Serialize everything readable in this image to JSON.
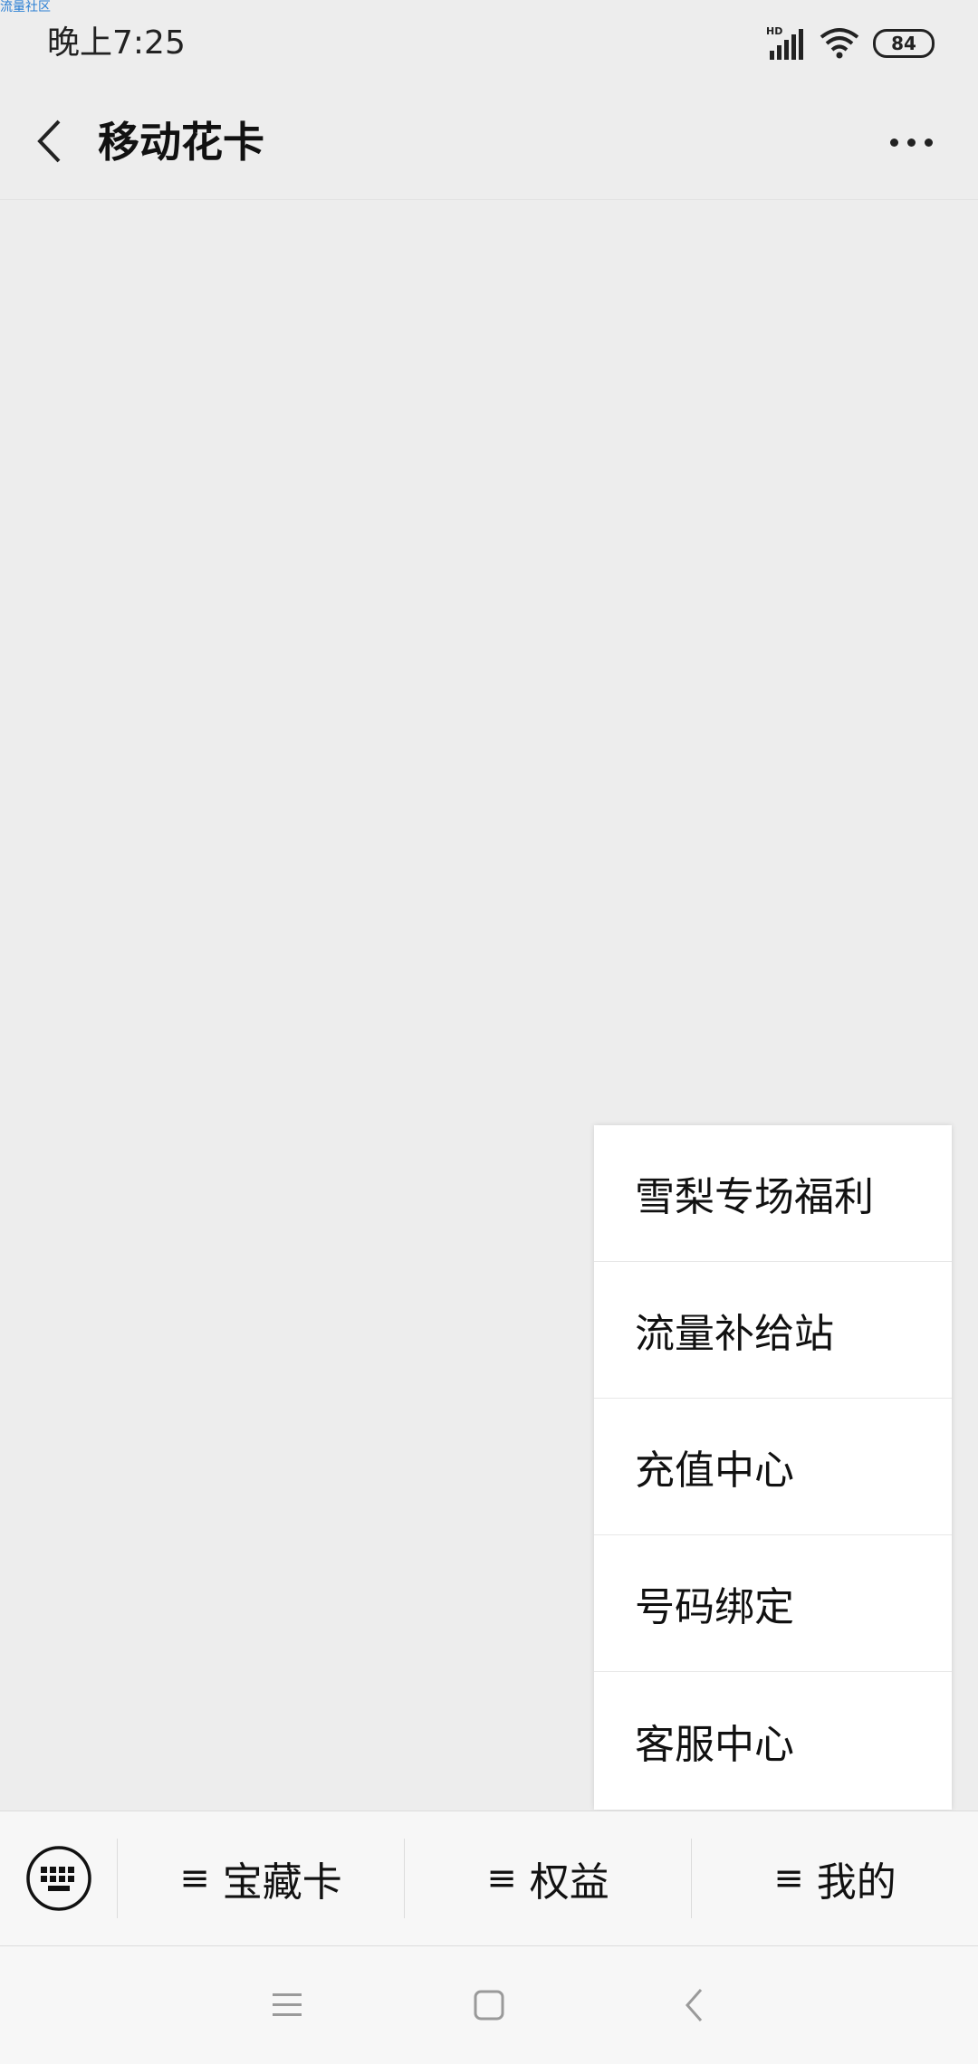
{
  "watermark": "流量社区",
  "status_bar": {
    "time": "晚上7:25",
    "network_label": "HD",
    "battery": "84"
  },
  "title_bar": {
    "title": "移动花卡"
  },
  "popup_menu": {
    "items": [
      {
        "label": "雪梨专场福利"
      },
      {
        "label": "流量补给站"
      },
      {
        "label": "充值中心"
      },
      {
        "label": "号码绑定"
      },
      {
        "label": "客服中心"
      }
    ]
  },
  "bottom_menu": {
    "tabs": [
      {
        "label": "宝藏卡"
      },
      {
        "label": "权益"
      },
      {
        "label": "我的"
      }
    ],
    "menu_glyph": "≡"
  },
  "icons": {
    "back": "back-arrow-icon",
    "more": "more-dots-icon",
    "keyboard": "keyboard-icon",
    "nav": [
      "nav-menu-icon",
      "nav-home-icon",
      "nav-back-icon"
    ]
  },
  "colors": {
    "background": "#ededed",
    "menu_background": "#ffffff",
    "bar_background": "#f7f7f7",
    "watermark": "#2a7fd4"
  }
}
